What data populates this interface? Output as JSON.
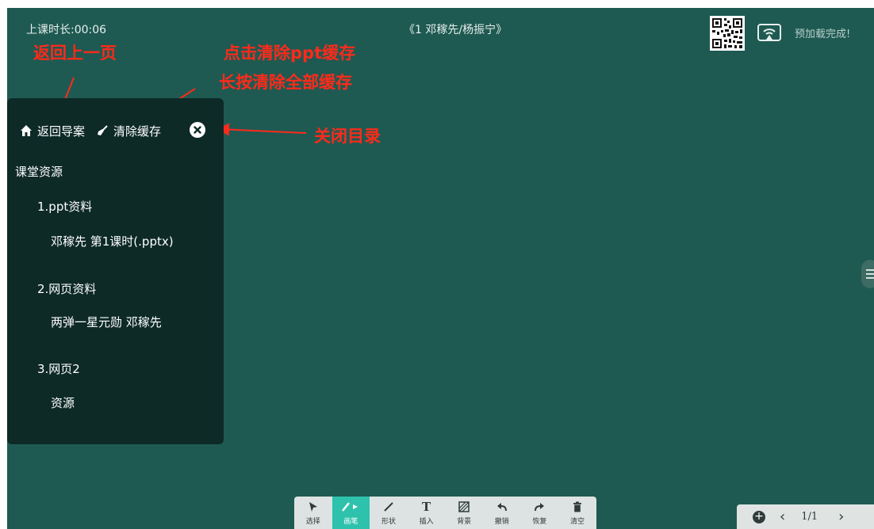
{
  "header": {
    "timer": "上课时长:00:06",
    "class_title": "《1 邓稼先/杨振宁》",
    "preload_status": "预加载完成!"
  },
  "annotations": {
    "back": "返回上一页",
    "clear_line1": "点击清除ppt缓存",
    "clear_line2": "长按清除全部缓存",
    "close": "关闭目录",
    "color": "#ff2a1a"
  },
  "catalog": {
    "back_label": "返回导案",
    "clear_label": "清除缓存",
    "section_title": "课堂资源",
    "items": [
      {
        "label": "1.ppt资料",
        "level": 1
      },
      {
        "label": "邓稼先 第1课时(.pptx)",
        "level": 2
      },
      {
        "label": "2.网页资料",
        "level": 1
      },
      {
        "label": "两弹一星元勋 邓稼先",
        "level": 2
      },
      {
        "label": "3.网页2",
        "level": 1
      },
      {
        "label": "资源",
        "level": 2
      }
    ]
  },
  "toolbar": {
    "tools": [
      {
        "label": "选择",
        "icon": "cursor-icon",
        "active": false
      },
      {
        "label": "画笔",
        "icon": "pen-icon",
        "active": true
      },
      {
        "label": "形状",
        "icon": "line-icon",
        "active": false
      },
      {
        "label": "插入",
        "icon": "text-t-icon",
        "active": false
      },
      {
        "label": "背景",
        "icon": "hatch-icon",
        "active": false
      },
      {
        "label": "撤销",
        "icon": "undo-icon",
        "active": false
      },
      {
        "label": "恢复",
        "icon": "redo-icon",
        "active": false
      },
      {
        "label": "清空",
        "icon": "trash-icon",
        "active": false
      }
    ]
  },
  "pager": {
    "page_indicator": "1/1"
  },
  "colors": {
    "board": "#1e5a52",
    "catalog_bg": "#0d2a27",
    "accent": "#2ec2ad"
  }
}
